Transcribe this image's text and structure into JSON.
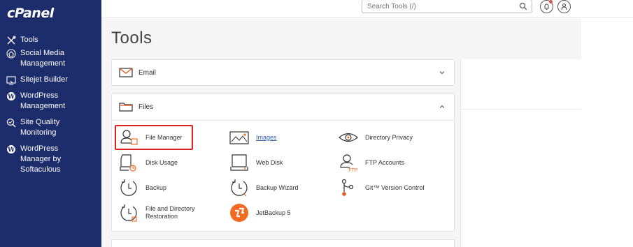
{
  "app": {
    "logo": "cPanel"
  },
  "sidebar": {
    "items": [
      {
        "label": "Tools",
        "icon": "tools-icon"
      },
      {
        "label": "Social Media\nManagement",
        "icon": "social-media-icon"
      },
      {
        "label": "Sitejet Builder",
        "icon": "sitejet-icon"
      },
      {
        "label": "WordPress\nManagement",
        "icon": "wordpress-icon"
      },
      {
        "label": "Site Quality\nMonitoring",
        "icon": "site-quality-icon"
      },
      {
        "label": "WordPress\nManager by\nSoftaculous",
        "icon": "wordpress-icon"
      }
    ]
  },
  "topbar": {
    "search_placeholder": "Search Tools (/)",
    "notification_icon": "bell-icon",
    "user_icon": "user-icon"
  },
  "page": {
    "title": "Tools"
  },
  "sections": {
    "email": {
      "title": "Email",
      "state": "collapsed"
    },
    "files": {
      "title": "Files",
      "state": "expanded",
      "tools": [
        {
          "label": "File Manager",
          "icon": "file-manager-icon",
          "selected": true
        },
        {
          "label": "Images",
          "icon": "images-icon",
          "link": true
        },
        {
          "label": "Directory Privacy",
          "icon": "eye-icon"
        },
        {
          "label": "Disk Usage",
          "icon": "disk-usage-icon"
        },
        {
          "label": "Web Disk",
          "icon": "web-disk-icon"
        },
        {
          "label": "FTP Accounts",
          "icon": "ftp-icon"
        },
        {
          "label": "Backup",
          "icon": "backup-icon"
        },
        {
          "label": "Backup Wizard",
          "icon": "backup-wizard-icon"
        },
        {
          "label": "Git™ Version Control",
          "icon": "git-icon"
        },
        {
          "label": "File and Directory\nRestoration",
          "icon": "restore-icon"
        },
        {
          "label": "JetBackup 5",
          "icon": "jetbackup-icon"
        }
      ]
    }
  },
  "colors": {
    "sidebar_bg": "#1d2d6b",
    "accent_orange": "#f26b21",
    "highlight_red": "#e02020",
    "link_blue": "#2d5ea8"
  }
}
